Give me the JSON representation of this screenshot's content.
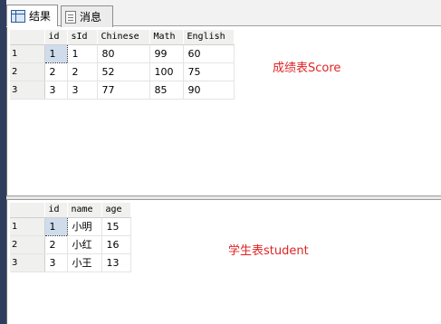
{
  "tabs": [
    {
      "label": "结果",
      "icon": "grid-icon",
      "active": true
    },
    {
      "label": "消息",
      "icon": "message-icon",
      "active": false
    }
  ],
  "score_table": {
    "columns": [
      "id",
      "sId",
      "Chinese",
      "Math",
      "English"
    ],
    "rows": [
      {
        "rownum": "1",
        "cells": [
          "1",
          "1",
          "80",
          "99",
          "60"
        ]
      },
      {
        "rownum": "2",
        "cells": [
          "2",
          "2",
          "52",
          "100",
          "75"
        ]
      },
      {
        "rownum": "3",
        "cells": [
          "3",
          "3",
          "77",
          "85",
          "90"
        ]
      }
    ],
    "caption": "成绩表Score"
  },
  "student_table": {
    "columns": [
      "id",
      "name",
      "age"
    ],
    "rows": [
      {
        "rownum": "1",
        "cells": [
          "1",
          "小明",
          "15"
        ]
      },
      {
        "rownum": "2",
        "cells": [
          "2",
          "小红",
          "16"
        ]
      },
      {
        "rownum": "3",
        "cells": [
          "3",
          "小王",
          "13"
        ]
      }
    ],
    "caption": "学生表student"
  },
  "colors": {
    "caption_text": "#e02424",
    "selected_cell": "#cfdcec",
    "header_bg": "#f0f0ee"
  }
}
